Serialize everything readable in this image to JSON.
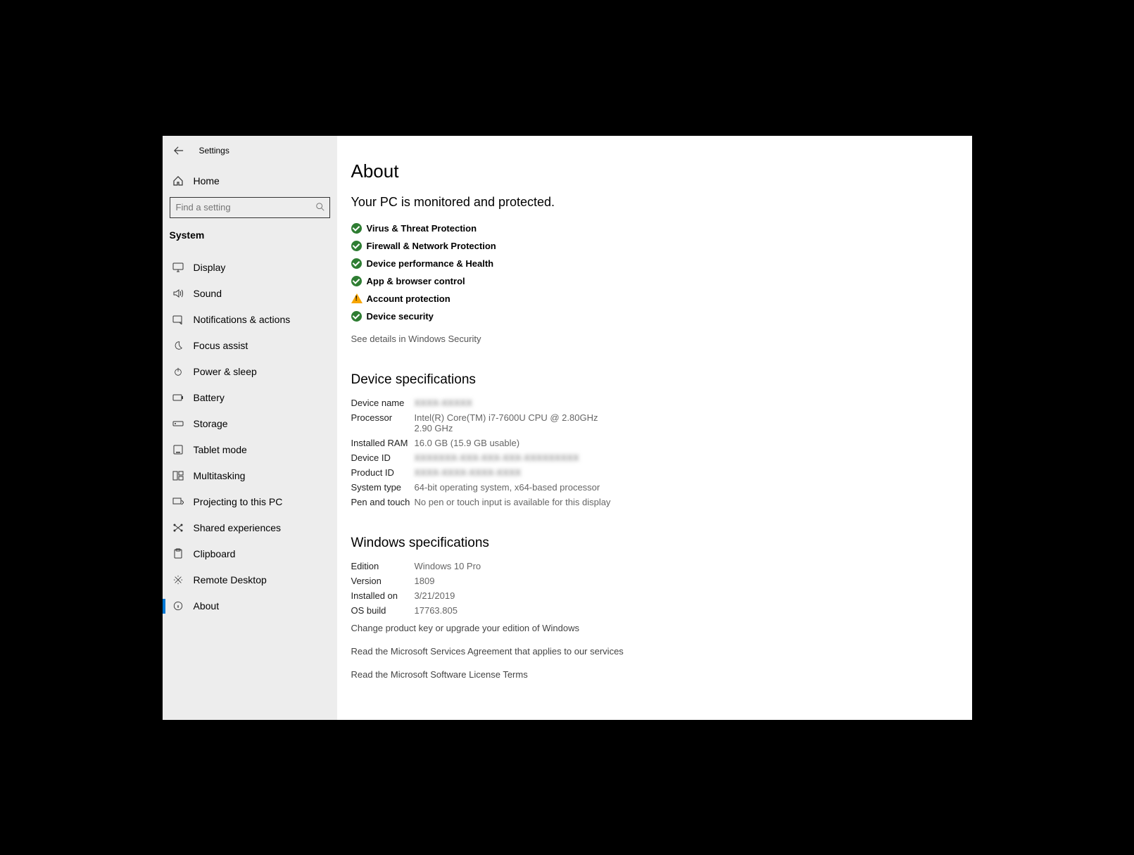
{
  "header": {
    "app_title": "Settings"
  },
  "home": {
    "label": "Home"
  },
  "search": {
    "placeholder": "Find a setting"
  },
  "category": "System",
  "nav": [
    {
      "label": "Display"
    },
    {
      "label": "Sound"
    },
    {
      "label": "Notifications & actions"
    },
    {
      "label": "Focus assist"
    },
    {
      "label": "Power & sleep"
    },
    {
      "label": "Battery"
    },
    {
      "label": "Storage"
    },
    {
      "label": "Tablet mode"
    },
    {
      "label": "Multitasking"
    },
    {
      "label": "Projecting to this PC"
    },
    {
      "label": "Shared experiences"
    },
    {
      "label": "Clipboard"
    },
    {
      "label": "Remote Desktop"
    },
    {
      "label": "About"
    }
  ],
  "main": {
    "title": "About",
    "subtitle": "Your PC is monitored and protected.",
    "protection": [
      {
        "label": "Virus & Threat Protection",
        "status": "ok"
      },
      {
        "label": "Firewall & Network Protection",
        "status": "ok"
      },
      {
        "label": "Device performance & Health",
        "status": "ok"
      },
      {
        "label": "App & browser control",
        "status": "ok"
      },
      {
        "label": "Account protection",
        "status": "warn"
      },
      {
        "label": "Device security",
        "status": "ok"
      }
    ],
    "security_link": "See details in Windows Security",
    "device_spec_header": "Device specifications",
    "device_specs": {
      "device_name_k": "Device name",
      "device_name_v": "XXXX-XXXXX",
      "processor_k": "Processor",
      "processor_v": "Intel(R) Core(TM) i7-7600U CPU @ 2.80GHz   2.90 GHz",
      "ram_k": "Installed RAM",
      "ram_v": "16.0 GB (15.9 GB usable)",
      "deviceid_k": "Device ID",
      "deviceid_v": "XXXXXXX-XXX-XXX-XXX-XXXXXXXXX",
      "productid_k": "Product ID",
      "productid_v": "XXXX-XXXX-XXXX-XXXX",
      "systype_k": "System type",
      "systype_v": "64-bit operating system, x64-based processor",
      "pen_k": "Pen and touch",
      "pen_v": "No pen or touch input is available for this display"
    },
    "win_spec_header": "Windows specifications",
    "win_specs": {
      "edition_k": "Edition",
      "edition_v": "Windows 10 Pro",
      "version_k": "Version",
      "version_v": "1809",
      "installed_k": "Installed on",
      "installed_v": "3/21/2019",
      "osbuild_k": "OS build",
      "osbuild_v": "17763.805"
    },
    "links": {
      "change_key": "Change product key or upgrade your edition of Windows",
      "msa": "Read the Microsoft Services Agreement that applies to our services",
      "license": "Read the Microsoft Software License Terms"
    }
  }
}
